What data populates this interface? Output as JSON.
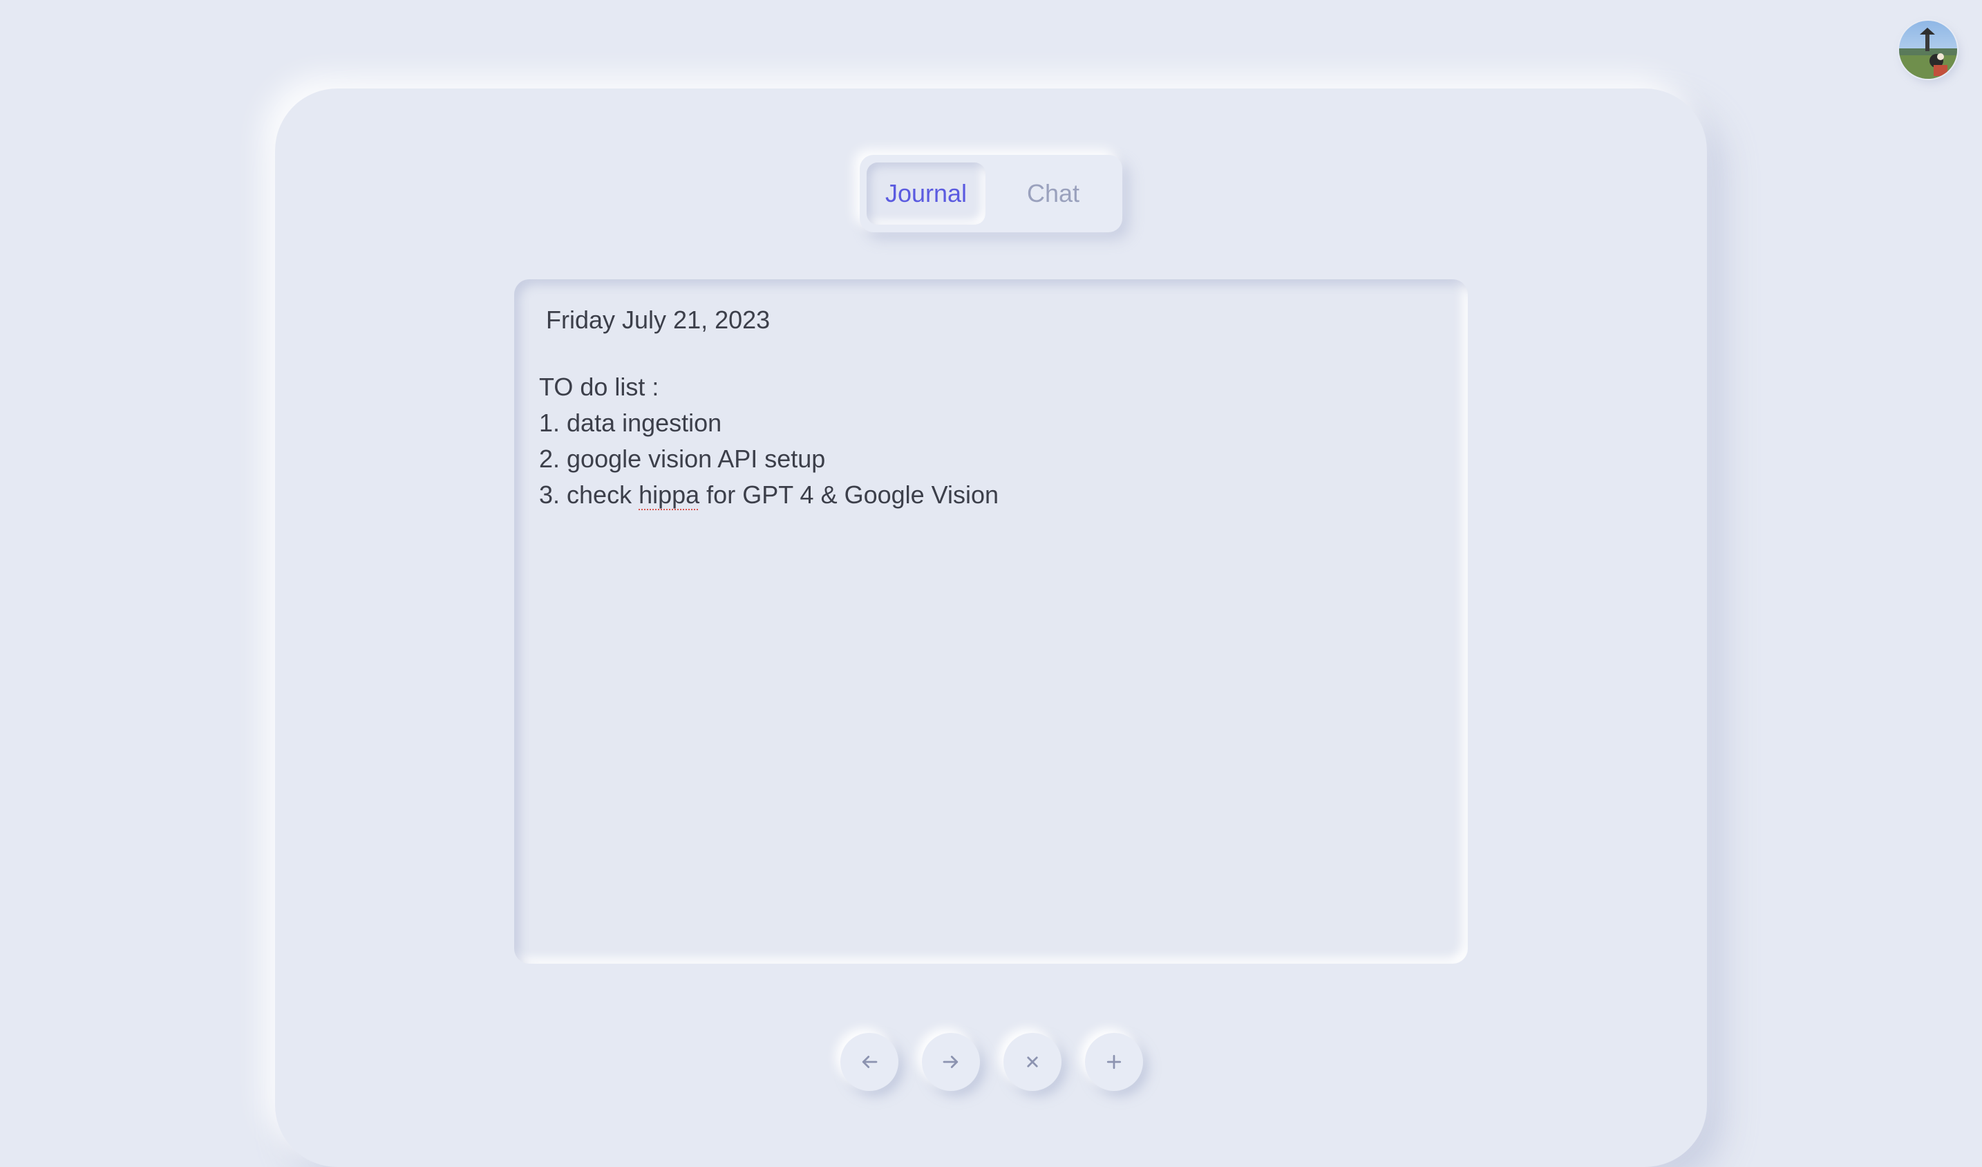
{
  "user": {
    "avatar_icon": "user-avatar-photo"
  },
  "tabs": [
    {
      "label": "Journal",
      "active": true
    },
    {
      "label": "Chat",
      "active": false
    }
  ],
  "journal": {
    "date": "Friday July 21, 2023",
    "lines": [
      "TO do list :",
      "1. data ingestion",
      "2. google vision API setup",
      "3. check ",
      "hippa",
      " for GPT 4 & Google Vision"
    ]
  },
  "actions": [
    {
      "name": "previous",
      "icon": "arrow-left-icon"
    },
    {
      "name": "next",
      "icon": "arrow-right-icon"
    },
    {
      "name": "delete",
      "icon": "close-icon"
    },
    {
      "name": "add",
      "icon": "plus-icon"
    }
  ],
  "colors": {
    "background": "#e5e9f3",
    "accent": "#5b5be0",
    "muted": "#9aa1bd",
    "text": "#3c3f4a"
  }
}
